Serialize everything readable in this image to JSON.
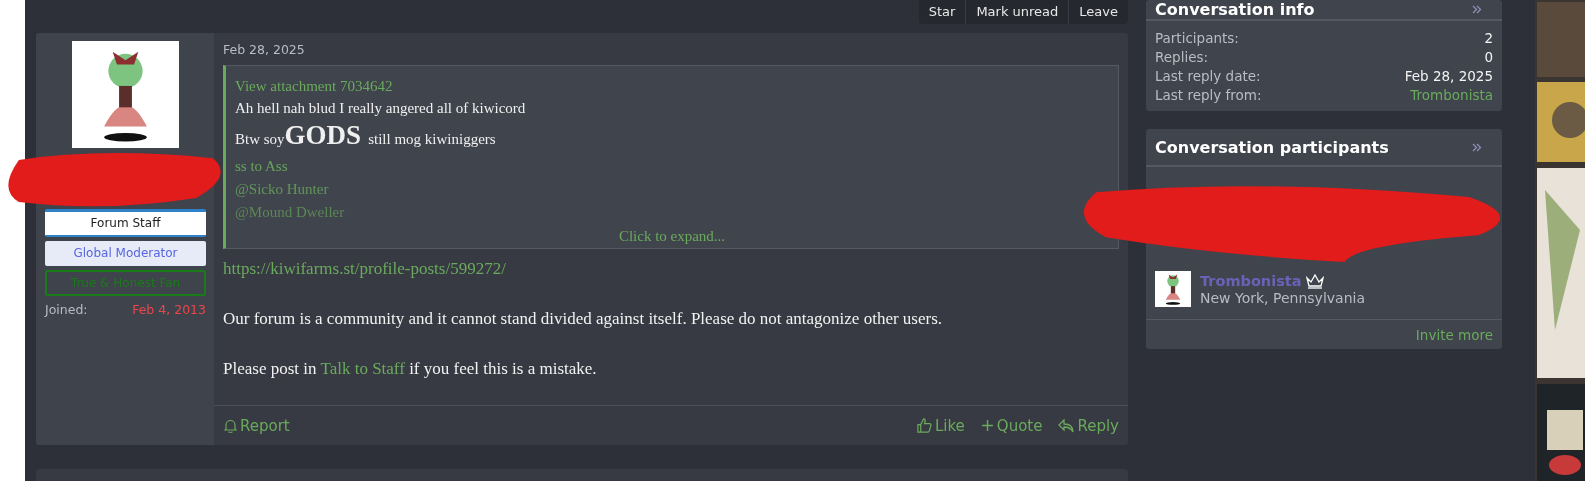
{
  "toolbar": {
    "buttons": [
      "Star",
      "Mark unread",
      "Leave"
    ]
  },
  "post": {
    "user_badges": [
      {
        "label": "Forum Staff",
        "kind": "staff"
      },
      {
        "label": "Global Moderator",
        "kind": "moderator"
      },
      {
        "label": "True & Honest Fan",
        "kind": "fan"
      }
    ],
    "joined": {
      "label": "Joined:",
      "value": "Feb 4, 2013"
    },
    "date": "Feb 28, 2025",
    "quote": {
      "attachment": "View attachment 7034642",
      "lines": [
        "Ah hell nah blud I really angered all of kiwicord"
      ],
      "big_line": {
        "before": "Btw soy",
        "big": "GODS",
        "after": "still mog kiwiniggers"
      },
      "faded": [
        "ss to Ass",
        "@Sicko Hunter",
        "@Mound Dweller"
      ],
      "expand": "Click to expand..."
    },
    "link": "https://kiwifarms.st/profile-posts/599272/",
    "paragraphs": [
      {
        "text": "Our forum is a community and it cannot stand divided against itself. Please do not antagonize other users."
      },
      {
        "before": "Please post in ",
        "link": "Talk to Staff",
        "after": " if you feel this is a mistake."
      }
    ],
    "report": "Report",
    "actions": [
      {
        "label": "Like",
        "kind": "like"
      },
      {
        "label": "Quote",
        "kind": "quote"
      },
      {
        "label": "Reply",
        "kind": "reply"
      }
    ]
  },
  "conversation_info": {
    "title": "Conversation info",
    "rows": [
      {
        "label": "Participants:",
        "value": "2",
        "kind": "plain"
      },
      {
        "label": "Replies:",
        "value": "0",
        "kind": "plain"
      },
      {
        "label": "Last reply date:",
        "value": "Feb 28, 2025",
        "kind": "plain"
      },
      {
        "label": "Last reply from:",
        "value": "Trombonista",
        "kind": "link"
      }
    ]
  },
  "participants": {
    "title": "Conversation participants",
    "members": [
      {
        "name": "Trombonista",
        "location": "New York, Pennsylvania",
        "crown": true
      }
    ],
    "invite": "Invite more"
  }
}
